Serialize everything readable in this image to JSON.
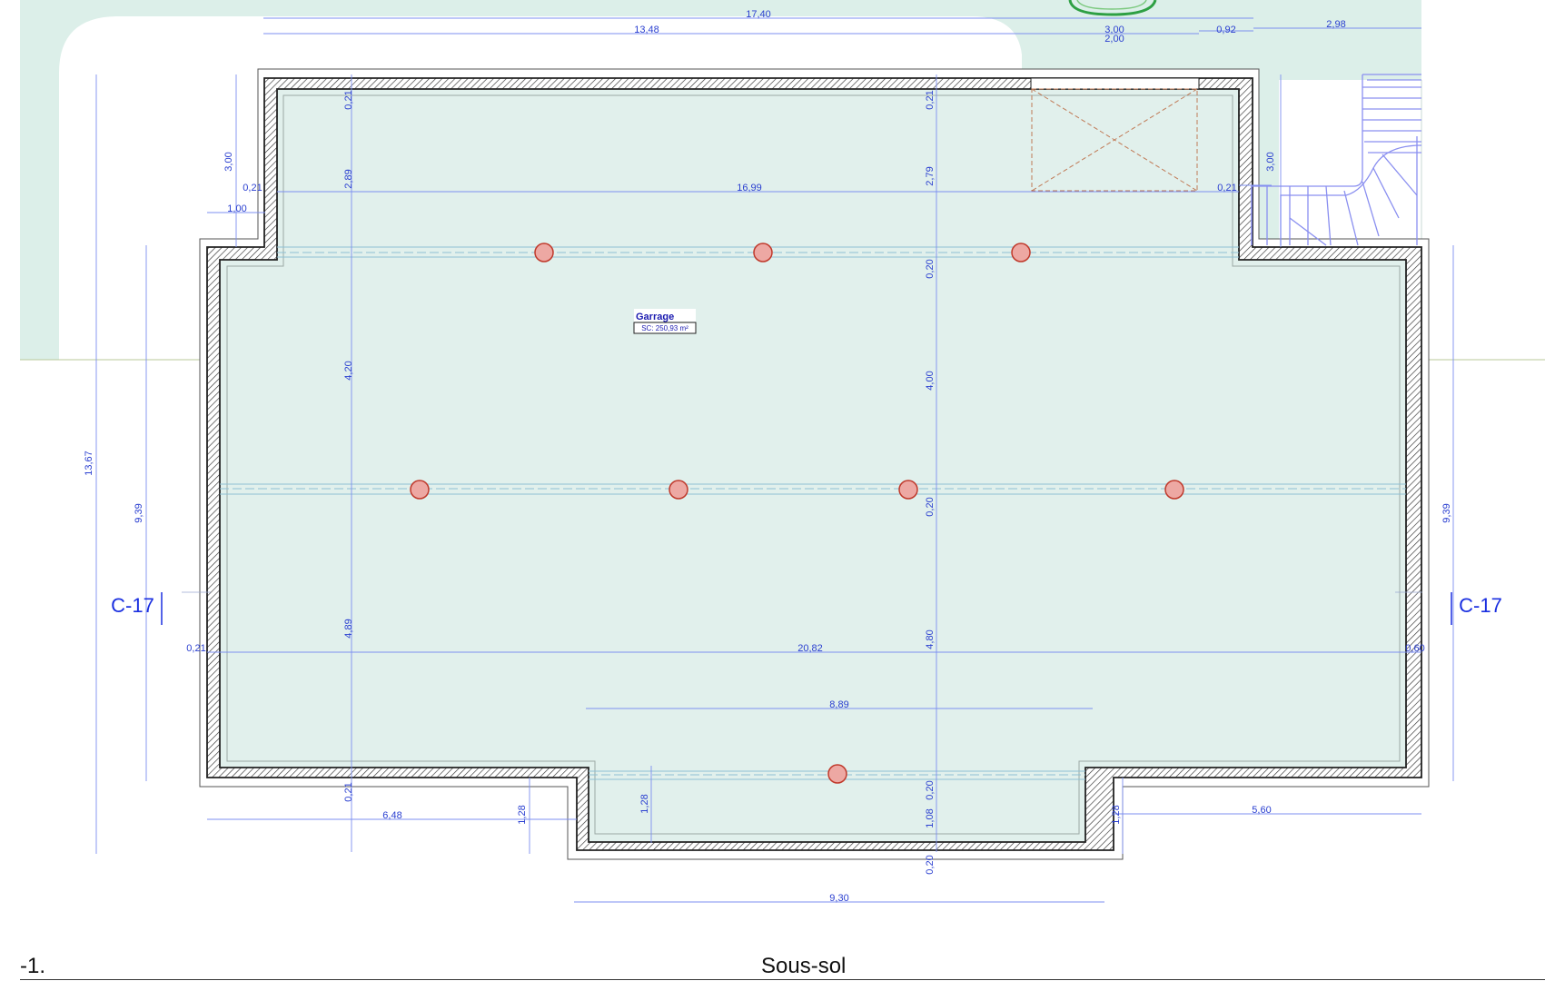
{
  "room": {
    "name": "Garrage",
    "area": "SC: 250,93 m²"
  },
  "section_marks": {
    "left": "C-17",
    "right": "C-17"
  },
  "footer": {
    "level": "-1.",
    "title": "Sous-sol"
  },
  "colors": {
    "dimension": "#2a3fd0",
    "floor": "#e1f0ec",
    "wall": "#222222",
    "column_fill": "#eda8a3",
    "column_stroke": "#c0392b",
    "stair": "#8a8ff0",
    "terrain": "#dcefe9"
  },
  "dimensions": [
    {
      "id": "top-total",
      "label": "17,40"
    },
    {
      "id": "top-inner",
      "label": "13,48"
    },
    {
      "id": "top-opening-a",
      "label": "3,00"
    },
    {
      "id": "top-opening-b",
      "label": "2,00"
    },
    {
      "id": "top-small",
      "label": "0,92"
    },
    {
      "id": "top-right",
      "label": "2,98"
    },
    {
      "id": "upper-width",
      "label": "16,99"
    },
    {
      "id": "left-offset",
      "label": "0,21"
    },
    {
      "id": "left-step",
      "label": "1,00"
    },
    {
      "id": "left-height",
      "label": "3,00"
    },
    {
      "id": "right-height",
      "label": "3,00"
    },
    {
      "id": "right-offset",
      "label": "0,21"
    },
    {
      "id": "wall-top-a",
      "label": "0,21"
    },
    {
      "id": "wall-top-b",
      "label": "0,21"
    },
    {
      "id": "span-a-1",
      "label": "2,89"
    },
    {
      "id": "span-b-1",
      "label": "2,79"
    },
    {
      "id": "beam-b-1",
      "label": "0,20"
    },
    {
      "id": "span-a-2",
      "label": "4,20"
    },
    {
      "id": "span-b-2",
      "label": "4,00"
    },
    {
      "id": "beam-b-2",
      "label": "0,20"
    },
    {
      "id": "span-a-3",
      "label": "4,89"
    },
    {
      "id": "span-b-3",
      "label": "4,80"
    },
    {
      "id": "total-height",
      "label": "13,67"
    },
    {
      "id": "left-main-height",
      "label": "9,39"
    },
    {
      "id": "right-main-height",
      "label": "9,39"
    },
    {
      "id": "main-width",
      "label": "20,82"
    },
    {
      "id": "main-left-wall",
      "label": "0,21"
    },
    {
      "id": "main-right-wall",
      "label": "0,60"
    },
    {
      "id": "bay-inner",
      "label": "8,89"
    },
    {
      "id": "wall-bottom-a",
      "label": "0,21"
    },
    {
      "id": "bottom-left",
      "label": "6,48"
    },
    {
      "id": "bay-depth-a",
      "label": "1,28"
    },
    {
      "id": "bay-depth-b",
      "label": "1,28"
    },
    {
      "id": "bay-depth-c",
      "label": "1,28"
    },
    {
      "id": "bottom-right",
      "label": "5,60"
    },
    {
      "id": "beam-b-3",
      "label": "0,20"
    },
    {
      "id": "bay-inner-depth",
      "label": "1,08"
    },
    {
      "id": "wall-bottom-b",
      "label": "0,20"
    },
    {
      "id": "bay-outer",
      "label": "9,30"
    }
  ]
}
